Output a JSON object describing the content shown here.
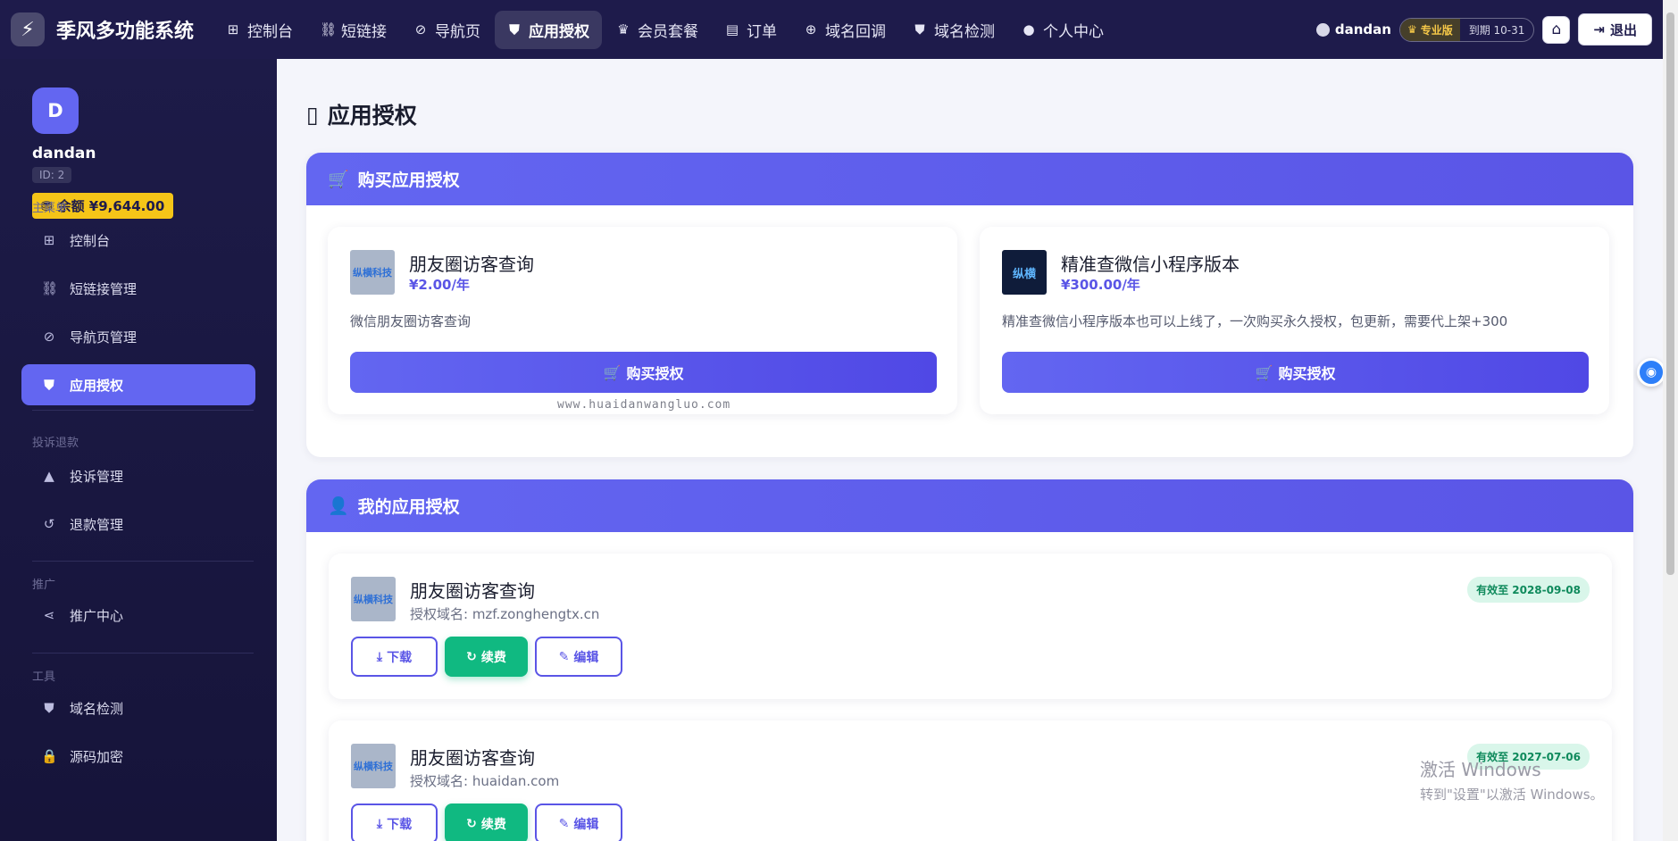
{
  "app": {
    "title": "季风多功能系统"
  },
  "topnav": {
    "items": [
      {
        "label": "控制台",
        "icon": "grid-icon",
        "glyph": "⊞"
      },
      {
        "label": "短链接",
        "icon": "link-icon",
        "glyph": "🔗"
      },
      {
        "label": "导航页",
        "icon": "compass-icon",
        "glyph": "⊘"
      },
      {
        "label": "应用授权",
        "icon": "shield-icon",
        "glyph": "⛊"
      },
      {
        "label": "会员套餐",
        "icon": "crown-icon",
        "glyph": "♛"
      },
      {
        "label": "订单",
        "icon": "receipt-icon",
        "glyph": "▤"
      },
      {
        "label": "域名回调",
        "icon": "globe-icon",
        "glyph": "⊕"
      },
      {
        "label": "域名检测",
        "icon": "shield-check-icon",
        "glyph": "⛊"
      },
      {
        "label": "个人中心",
        "icon": "user-icon",
        "glyph": "👤"
      }
    ],
    "user": "dandan",
    "plan": "专业版",
    "expiry": "到期 10-31",
    "logout": "退出"
  },
  "sidebar": {
    "avatar_letter": "D",
    "username": "dandan",
    "user_id": "ID: 2",
    "balance": "余额 ¥9,644.00",
    "sections": {
      "main": "主菜单",
      "complaint": "投诉退款",
      "promo": "推广",
      "tools": "工具"
    },
    "items": [
      {
        "label": "控制台"
      },
      {
        "label": "短链接管理"
      },
      {
        "label": "导航页管理"
      },
      {
        "label": "应用授权"
      },
      {
        "label": "投诉管理"
      },
      {
        "label": "退款管理"
      },
      {
        "label": "推广中心"
      },
      {
        "label": "域名检测"
      },
      {
        "label": "源码加密"
      }
    ]
  },
  "page": {
    "title": "应用授权",
    "buy_section": {
      "header": "购买应用授权",
      "products": [
        {
          "name": "朋友圈访客查询",
          "price": "¥2.00/年",
          "desc": "微信朋友圈访客查询",
          "button": "购买授权",
          "thumb_text": "纵横科技"
        },
        {
          "name": "精准查微信小程序版本",
          "price": "¥300.00/年",
          "desc": "精准查微信小程序版本也可以上线了，一次购买永久授权，包更新，需要代上架+300",
          "button": "购买授权",
          "thumb_text": "纵横"
        }
      ]
    },
    "my_section": {
      "header": "我的应用授权",
      "licenses": [
        {
          "name": "朋友圈访客查询",
          "domain": "授权域名: mzf.zonghengtx.cn",
          "valid": "有效至 2028-09-08",
          "download": "下载",
          "renew": "续费",
          "edit": "编辑",
          "thumb_text": "纵横科技"
        },
        {
          "name": "朋友圈访客查询",
          "domain": "授权域名: huaidan.com",
          "valid": "有效至 2027-07-06",
          "download": "下载",
          "renew": "续费",
          "edit": "编辑",
          "thumb_text": "纵横科技"
        }
      ]
    }
  },
  "overlay": {
    "watermark": "www.huaidanwangluo.com",
    "win_activate_title": "激活 Windows",
    "win_activate_sub": "转到\"设置\"以激活 Windows。"
  },
  "colors": {
    "primary": "#6366f1",
    "nav_bg": "#1e1b4b",
    "success": "#10b981",
    "gold": "#f5c518"
  }
}
